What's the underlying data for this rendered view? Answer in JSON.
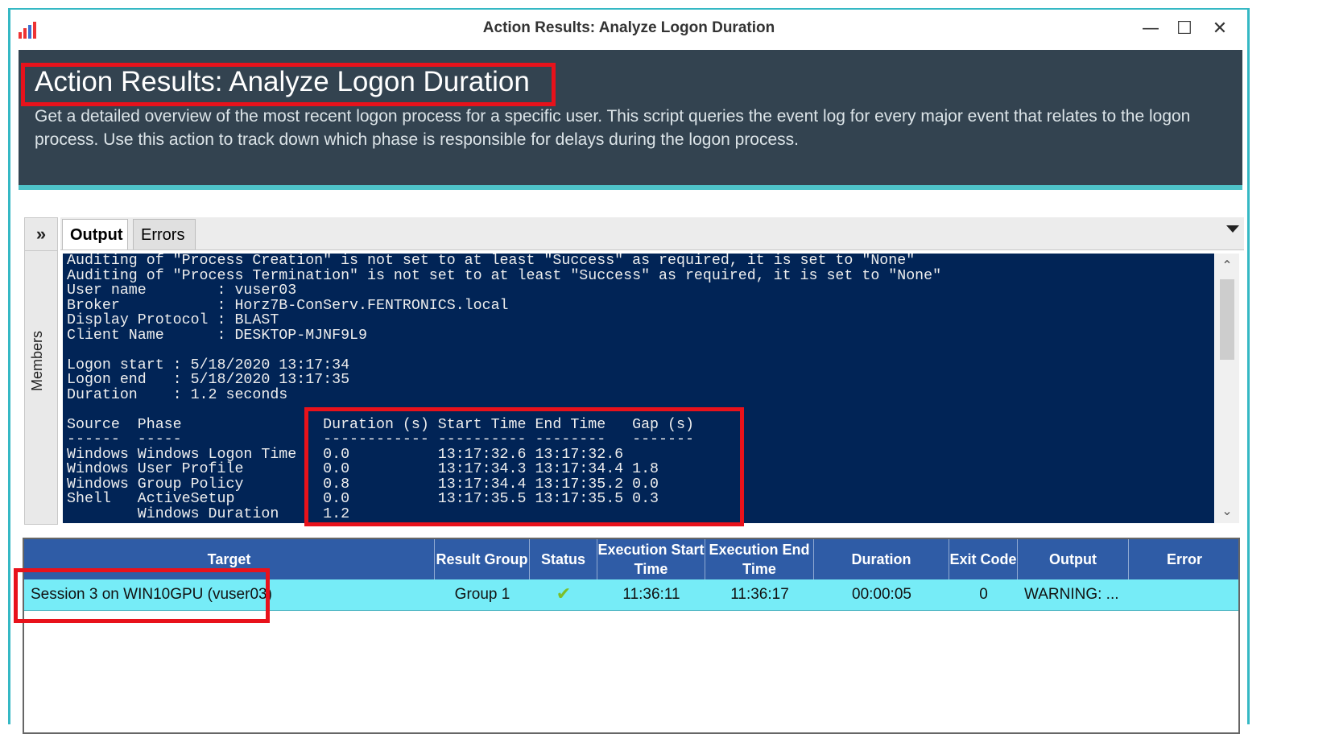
{
  "window": {
    "title": "Action Results: Analyze Logon Duration",
    "controls": {
      "minimize": "—",
      "maximize": "☐",
      "close": "✕"
    },
    "icon": "bar-chart-app-icon"
  },
  "header": {
    "title": "Action Results: Analyze Logon Duration",
    "description": "Get a detailed overview of the most recent logon process for a specific user. This script queries the event log for every major event that relates to the logon process. Use this action to track down which phase is responsible for delays during the logon process."
  },
  "sidebar": {
    "expand_label": "»",
    "members_label": "Members"
  },
  "tabs": [
    {
      "label": "Output",
      "active": true
    },
    {
      "label": "Errors",
      "active": false
    }
  ],
  "console": {
    "lines": [
      "Auditing of \"Process Creation\" is not set to at least \"Success\" as required, it is set to \"None\"",
      "Auditing of \"Process Termination\" is not set to at least \"Success\" as required, it is set to \"None\"",
      "User name        : vuser03",
      "Broker           : Horz7B-ConServ.FENTRONICS.local",
      "Display Protocol : BLAST",
      "Client Name      : DESKTOP-MJNF9L9",
      "",
      "Logon start : 5/18/2020 13:17:34",
      "Logon end   : 5/18/2020 13:17:35",
      "Duration    : 1.2 seconds",
      "",
      "Source  Phase                Duration (s) Start Time End Time   Gap (s)",
      "------  -----                ------------ ---------- --------   -------",
      "Windows Windows Logon Time   0.0          13:17:32.6 13:17:32.6",
      "Windows User Profile         0.0          13:17:34.3 13:17:34.4 1.8",
      "Windows Group Policy         0.8          13:17:34.4 13:17:35.2 0.0",
      "Shell   ActiveSetup          0.0          13:17:35.5 13:17:35.5 0.3",
      "        Windows Duration     1.2"
    ]
  },
  "results_table": {
    "columns": [
      "Target",
      "Result Group",
      "Status",
      "Execution Start Time",
      "Execution End Time",
      "Duration",
      "Exit Code",
      "Output",
      "Error"
    ],
    "rows": [
      {
        "target": "Session 3 on WIN10GPU (vuser03)",
        "result_group": "Group 1",
        "status": "✔",
        "start": "11:36:11",
        "end": "11:36:17",
        "duration": "00:00:05",
        "exit_code": "0",
        "output": "WARNING: ...",
        "error": ""
      }
    ]
  },
  "colors": {
    "header_bg": "#334350",
    "accent_teal": "#4ec3c9",
    "console_bg": "#012456",
    "grid_header_bg": "#2f5ca6",
    "selected_row_bg": "#76ecf7",
    "highlight_red": "#e8121b",
    "status_ok": "#7cbf28"
  }
}
